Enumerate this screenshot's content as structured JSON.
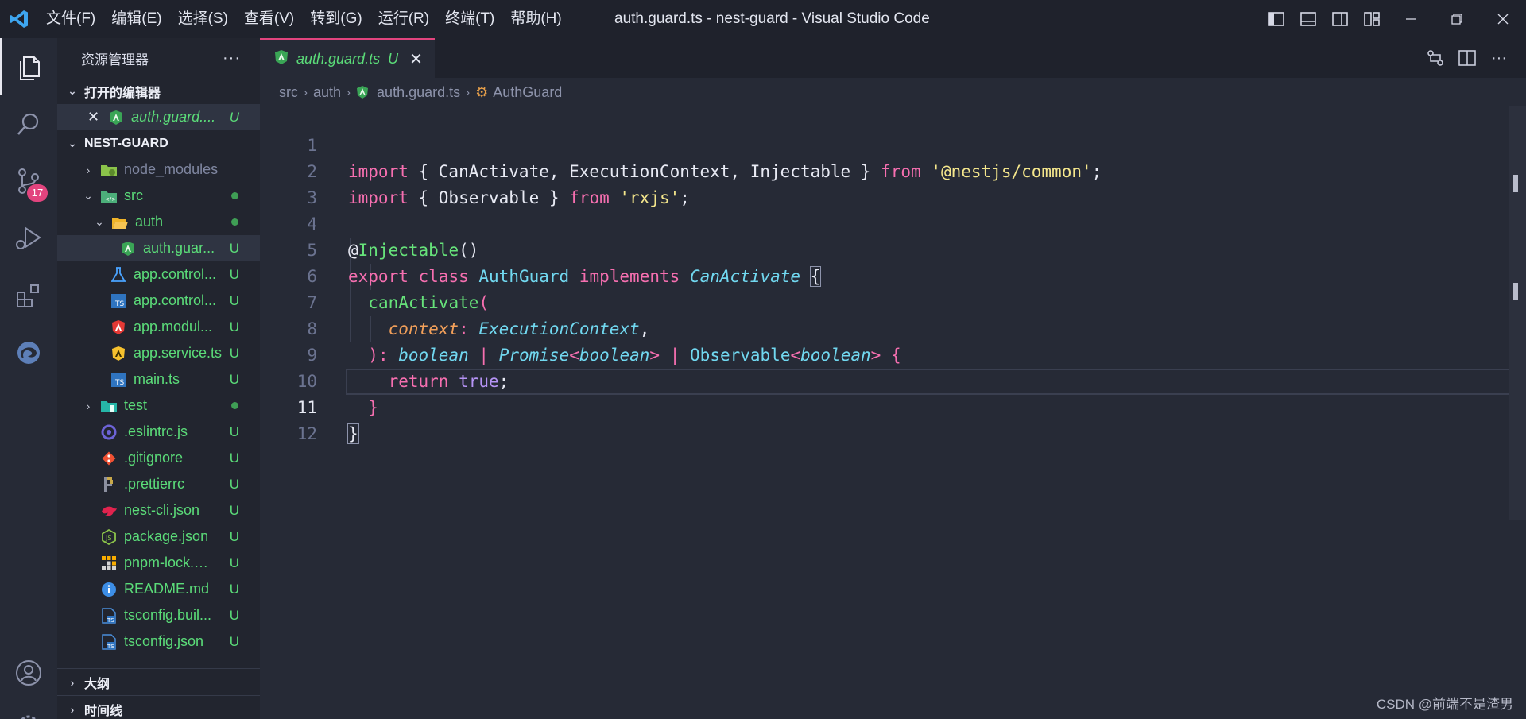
{
  "titlebar": {
    "menu": [
      "文件(F)",
      "编辑(E)",
      "选择(S)",
      "查看(V)",
      "转到(G)",
      "运行(R)",
      "终端(T)",
      "帮助(H)"
    ],
    "title": "auth.guard.ts - nest-guard - Visual Studio Code",
    "window_controls": [
      "minimize-icon",
      "restore-icon",
      "close-icon"
    ]
  },
  "activitybar": {
    "items": [
      "explorer-icon",
      "search-icon",
      "source-control-icon",
      "run-debug-icon",
      "extensions-icon",
      "edge-devtools-icon"
    ],
    "scm_badge": "17",
    "bottom": [
      "account-icon",
      "settings-gear-icon"
    ]
  },
  "sidebar": {
    "title": "资源管理器",
    "more": "···",
    "open_editors_title": "打开的编辑器",
    "open_editor": {
      "name": "auth.guard....",
      "status": "U"
    },
    "project_title": "NEST-GUARD",
    "tree": [
      {
        "name": "node_modules",
        "status": ""
      },
      {
        "name": "src",
        "status": "dot"
      },
      {
        "name": "auth",
        "status": "dot"
      },
      {
        "name": "auth.guar...",
        "status": "U"
      },
      {
        "name": "app.control...",
        "status": "U"
      },
      {
        "name": "app.control...",
        "status": "U"
      },
      {
        "name": "app.modul...",
        "status": "U"
      },
      {
        "name": "app.service.ts",
        "status": "U"
      },
      {
        "name": "main.ts",
        "status": "U"
      },
      {
        "name": "test",
        "status": "dot"
      },
      {
        "name": ".eslintrc.js",
        "status": "U"
      },
      {
        "name": ".gitignore",
        "status": "U"
      },
      {
        "name": ".prettierrc",
        "status": "U"
      },
      {
        "name": "nest-cli.json",
        "status": "U"
      },
      {
        "name": "package.json",
        "status": "U"
      },
      {
        "name": "pnpm-lock.y...",
        "status": "U"
      },
      {
        "name": "README.md",
        "status": "U"
      },
      {
        "name": "tsconfig.buil...",
        "status": "U"
      },
      {
        "name": "tsconfig.json",
        "status": "U"
      }
    ],
    "outline_title": "大纲",
    "timeline_title": "时间线"
  },
  "editor": {
    "tab": {
      "label": "auth.guard.ts",
      "status": "U",
      "close": "✕"
    },
    "breadcrumb": [
      "src",
      "auth",
      "auth.guard.ts",
      "AuthGuard"
    ],
    "line_numbers": [
      "1",
      "2",
      "3",
      "4",
      "5",
      "6",
      "7",
      "8",
      "9",
      "10",
      "11",
      "12"
    ],
    "current_line": "11"
  },
  "colors": {
    "accent": "#e2447e",
    "git_untracked": "#5bdc79",
    "background": "#262a36"
  },
  "watermark": "CSDN @前端不是渣男"
}
